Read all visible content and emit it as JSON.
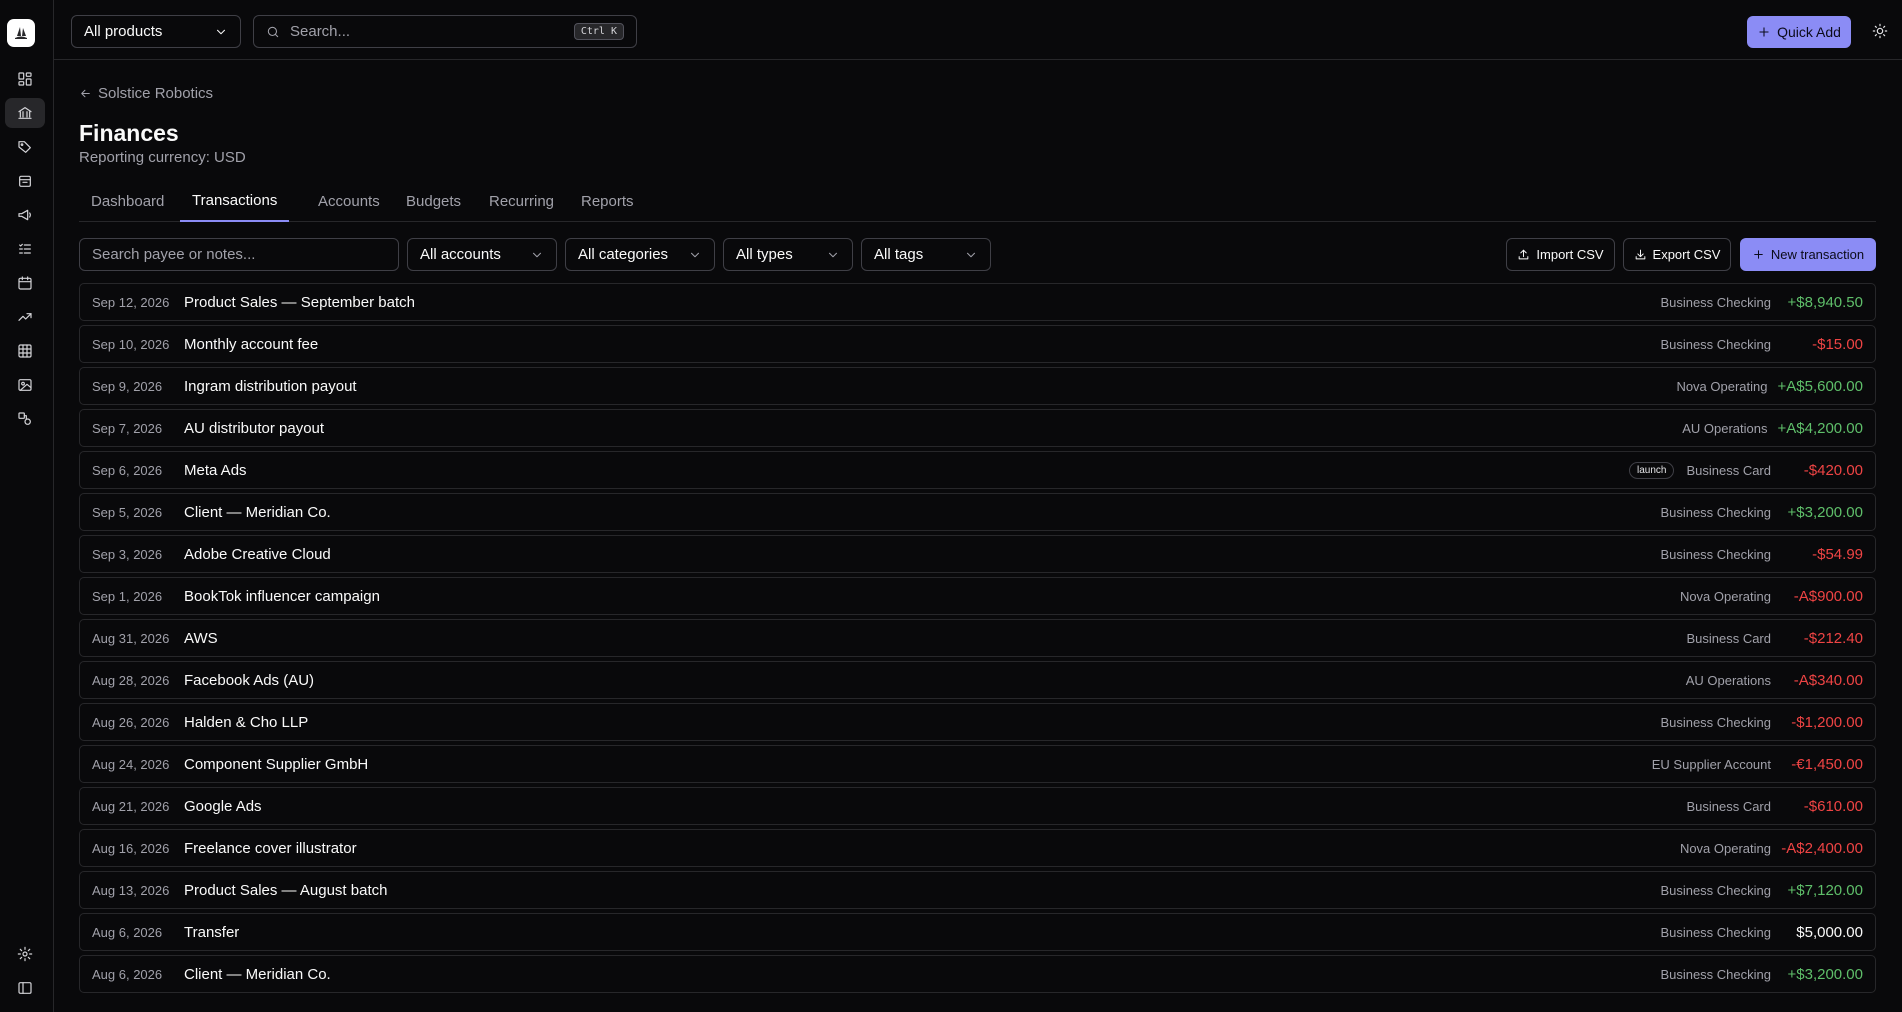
{
  "topbar": {
    "product_select": "All products",
    "search_placeholder": "Search...",
    "search_shortcut": "Ctrl K",
    "quick_add_label": "Quick Add"
  },
  "page": {
    "back_label": "Solstice Robotics",
    "title": "Finances",
    "subtitle": "Reporting currency: USD"
  },
  "tabs": [
    {
      "label": "Dashboard"
    },
    {
      "label": "Transactions"
    },
    {
      "label": "Accounts"
    },
    {
      "label": "Budgets"
    },
    {
      "label": "Recurring"
    },
    {
      "label": "Reports"
    }
  ],
  "active_tab": "Transactions",
  "filters": {
    "search_placeholder": "Search payee or notes...",
    "accounts": "All accounts",
    "categories": "All categories",
    "types": "All types",
    "tags": "All tags",
    "import_label": "Import CSV",
    "export_label": "Export CSV",
    "new_label": "New transaction"
  },
  "transactions": [
    {
      "date": "Sep 12, 2026",
      "payee": "Product Sales — September batch",
      "tag": "",
      "account": "Business Checking",
      "amount": "+$8,940.50",
      "kind": "pos"
    },
    {
      "date": "Sep 10, 2026",
      "payee": "Monthly account fee",
      "tag": "",
      "account": "Business Checking",
      "amount": "-$15.00",
      "kind": "neg"
    },
    {
      "date": "Sep 9, 2026",
      "payee": "Ingram distribution payout",
      "tag": "",
      "account": "Nova Operating",
      "amount": "+A$5,600.00",
      "kind": "pos"
    },
    {
      "date": "Sep 7, 2026",
      "payee": "AU distributor payout",
      "tag": "",
      "account": "AU Operations",
      "amount": "+A$4,200.00",
      "kind": "pos"
    },
    {
      "date": "Sep 6, 2026",
      "payee": "Meta Ads",
      "tag": "launch",
      "account": "Business Card",
      "amount": "-$420.00",
      "kind": "neg"
    },
    {
      "date": "Sep 5, 2026",
      "payee": "Client — Meridian Co.",
      "tag": "",
      "account": "Business Checking",
      "amount": "+$3,200.00",
      "kind": "pos"
    },
    {
      "date": "Sep 3, 2026",
      "payee": "Adobe Creative Cloud",
      "tag": "",
      "account": "Business Checking",
      "amount": "-$54.99",
      "kind": "neg"
    },
    {
      "date": "Sep 1, 2026",
      "payee": "BookTok influencer campaign",
      "tag": "",
      "account": "Nova Operating",
      "amount": "-A$900.00",
      "kind": "neg"
    },
    {
      "date": "Aug 31, 2026",
      "payee": "AWS",
      "tag": "",
      "account": "Business Card",
      "amount": "-$212.40",
      "kind": "neg"
    },
    {
      "date": "Aug 28, 2026",
      "payee": "Facebook Ads (AU)",
      "tag": "",
      "account": "AU Operations",
      "amount": "-A$340.00",
      "kind": "neg"
    },
    {
      "date": "Aug 26, 2026",
      "payee": "Halden & Cho LLP",
      "tag": "",
      "account": "Business Checking",
      "amount": "-$1,200.00",
      "kind": "neg"
    },
    {
      "date": "Aug 24, 2026",
      "payee": "Component Supplier GmbH",
      "tag": "",
      "account": "EU Supplier Account",
      "amount": "-€1,450.00",
      "kind": "neg"
    },
    {
      "date": "Aug 21, 2026",
      "payee": "Google Ads",
      "tag": "",
      "account": "Business Card",
      "amount": "-$610.00",
      "kind": "neg"
    },
    {
      "date": "Aug 16, 2026",
      "payee": "Freelance cover illustrator",
      "tag": "",
      "account": "Nova Operating",
      "amount": "-A$2,400.00",
      "kind": "neg"
    },
    {
      "date": "Aug 13, 2026",
      "payee": "Product Sales — August batch",
      "tag": "",
      "account": "Business Checking",
      "amount": "+$7,120.00",
      "kind": "pos"
    },
    {
      "date": "Aug 6, 2026",
      "payee": "Transfer",
      "tag": "",
      "account": "Business Checking",
      "amount": "$5,000.00",
      "kind": "neutral"
    },
    {
      "date": "Aug 6, 2026",
      "payee": "Client — Meridian Co.",
      "tag": "",
      "account": "Business Checking",
      "amount": "+$3,200.00",
      "kind": "pos"
    }
  ],
  "colors": {
    "accent": "#8b8cf5",
    "positive": "#5fbf6a",
    "negative": "#ef4444",
    "background": "#09090b",
    "border": "#27272a"
  }
}
